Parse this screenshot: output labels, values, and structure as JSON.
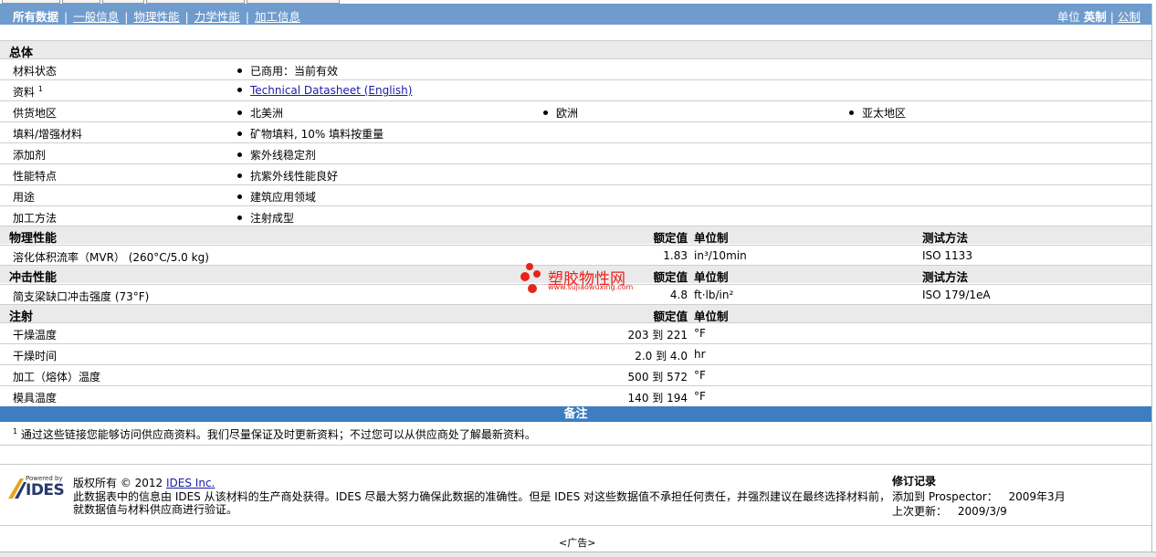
{
  "nav": {
    "tabs": [
      "所有数据",
      "一般信息",
      "物理性能",
      "力学性能",
      "加工信息"
    ],
    "unit_label": "单位",
    "unit_current": "英制",
    "unit_other": "公制"
  },
  "general": {
    "title": "总体",
    "rows": [
      {
        "label": "材料状态",
        "values": [
          "已商用：当前有效"
        ]
      },
      {
        "label": "资料",
        "sup": "1",
        "values": [
          "Technical Datasheet (English)"
        ],
        "link": true
      },
      {
        "label": "供货地区",
        "values": [
          "北美洲",
          "欧洲",
          "亚太地区"
        ]
      },
      {
        "label": "填料/增强材料",
        "values": [
          "矿物填料, 10% 填料按重量"
        ]
      },
      {
        "label": "添加剂",
        "values": [
          "紫外线稳定剂"
        ]
      },
      {
        "label": "性能特点",
        "values": [
          "抗紫外线性能良好"
        ]
      },
      {
        "label": "用途",
        "values": [
          "建筑应用领域"
        ]
      },
      {
        "label": "加工方法",
        "values": [
          "注射成型"
        ]
      }
    ]
  },
  "headers": {
    "nominal": "额定值",
    "unit": "单位制",
    "method": "测试方法"
  },
  "physical": {
    "title": "物理性能",
    "rows": [
      {
        "label": "溶化体积流率（MVR） (260°C/5.0 kg)",
        "value": "1.83",
        "unit": "in³/10min",
        "method": "ISO 1133"
      }
    ]
  },
  "impact": {
    "title": "冲击性能",
    "rows": [
      {
        "label": "简支梁缺口冲击强度 (73°F)",
        "value": "4.8",
        "unit": "ft·lb/in²",
        "method": "ISO 179/1eA"
      }
    ]
  },
  "injection": {
    "title": "注射",
    "rows": [
      {
        "label": "干燥温度",
        "value": "203 到  221",
        "unit": "°F"
      },
      {
        "label": "干燥时间",
        "value": "2.0 到  4.0",
        "unit": "hr"
      },
      {
        "label": "加工（熔体）温度",
        "value": "500 到  572",
        "unit": "°F"
      },
      {
        "label": "模具温度",
        "value": "140 到  194",
        "unit": "°F"
      }
    ]
  },
  "notes": {
    "title": "备注",
    "sup": "1",
    "text": "通过这些链接您能够访问供应商资料。我们尽量保证及时更新资料；不过您可以从供应商处了解最新资料。"
  },
  "watermark": {
    "title": "塑胶物性网",
    "url": "www.sujiaowuxing.com"
  },
  "footer": {
    "logo_small": "Powered by",
    "logo_name": "IDES",
    "copyright_prefix": "版权所有  © 2012",
    "copyright_link": "IDES Inc.",
    "disclaimer_1": "此数据表中的信息由  IDES 从该材料的生产商处获得。IDES 尽最大努力确保此数据的准确性。但是  IDES 对这些数据值不承担任何责任，并强烈建议在最终选择材料前，",
    "disclaimer_2": "就数据值与材料供应商进行验证。",
    "revision_title": "修订记录",
    "added_label": "添加到  Prospector：",
    "added_value": "2009年3月",
    "updated_label": "上次更新：",
    "updated_value": "2009/3/9",
    "ad": "<广告>"
  }
}
